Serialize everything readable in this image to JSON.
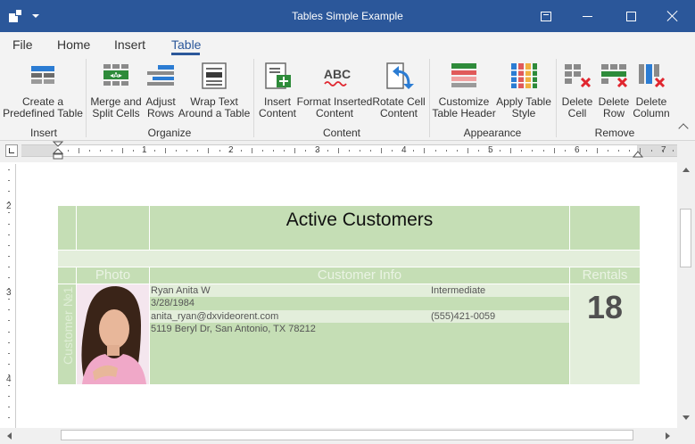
{
  "window": {
    "title": "Tables Simple Example"
  },
  "tabs": [
    {
      "label": "File"
    },
    {
      "label": "Home"
    },
    {
      "label": "Insert"
    },
    {
      "label": "Table"
    }
  ],
  "ribbon": {
    "groups": [
      {
        "label": "Insert"
      },
      {
        "label": "Organize"
      },
      {
        "label": "Content"
      },
      {
        "label": "Appearance"
      },
      {
        "label": "Remove"
      }
    ],
    "buttons": [
      {
        "line1": "Create a",
        "line2": "Predefined Table",
        "icon": "predefined-table-icon"
      },
      {
        "line1": "Merge and",
        "line2": "Split Cells",
        "icon": "merge-split-cells-icon"
      },
      {
        "line1": "Adjust",
        "line2": "Rows",
        "icon": "adjust-rows-icon"
      },
      {
        "line1": "Wrap Text",
        "line2": "Around a Table",
        "icon": "wrap-text-icon"
      },
      {
        "line1": "Insert",
        "line2": "Content",
        "icon": "insert-content-icon"
      },
      {
        "line1": "Format Inserted",
        "line2": "Content",
        "icon": "format-content-icon"
      },
      {
        "line1": "Rotate Cell",
        "line2": "Content",
        "icon": "rotate-cell-content-icon"
      },
      {
        "line1": "Customize",
        "line2": "Table Header",
        "icon": "customize-header-icon"
      },
      {
        "line1": "Apply Table",
        "line2": "Style",
        "icon": "apply-table-style-icon"
      },
      {
        "line1": "Delete",
        "line2": "Cell",
        "icon": "delete-cell-icon"
      },
      {
        "line1": "Delete",
        "line2": "Row",
        "icon": "delete-row-icon"
      },
      {
        "line1": "Delete",
        "line2": "Column",
        "icon": "delete-column-icon"
      }
    ],
    "abc_glyph": "ABC"
  },
  "ruler": {
    "h_numbers": [
      "1",
      "2",
      "3",
      "4",
      "5",
      "6",
      "7"
    ],
    "v_numbers": [
      "2",
      "3",
      "4"
    ]
  },
  "document": {
    "title": "Active Customers",
    "headers": {
      "photo": "Photo",
      "info": "Customer Info",
      "rentals": "Rentals",
      "side": "Customer №1"
    },
    "customer": {
      "name": "Ryan Anita W",
      "level": "Intermediate",
      "birthdate": "3/28/1984",
      "email": "anita_ryan@dxvideorent.com",
      "phone": "(555)421-0059",
      "address": "5119 Beryl Dr, San Antonio, TX 78212",
      "rentals": "18"
    }
  },
  "colors": {
    "accent": "#2b579a",
    "table_green": "#c5deb5",
    "table_light": "#e3eedb",
    "delete_red": "#e0262f"
  }
}
